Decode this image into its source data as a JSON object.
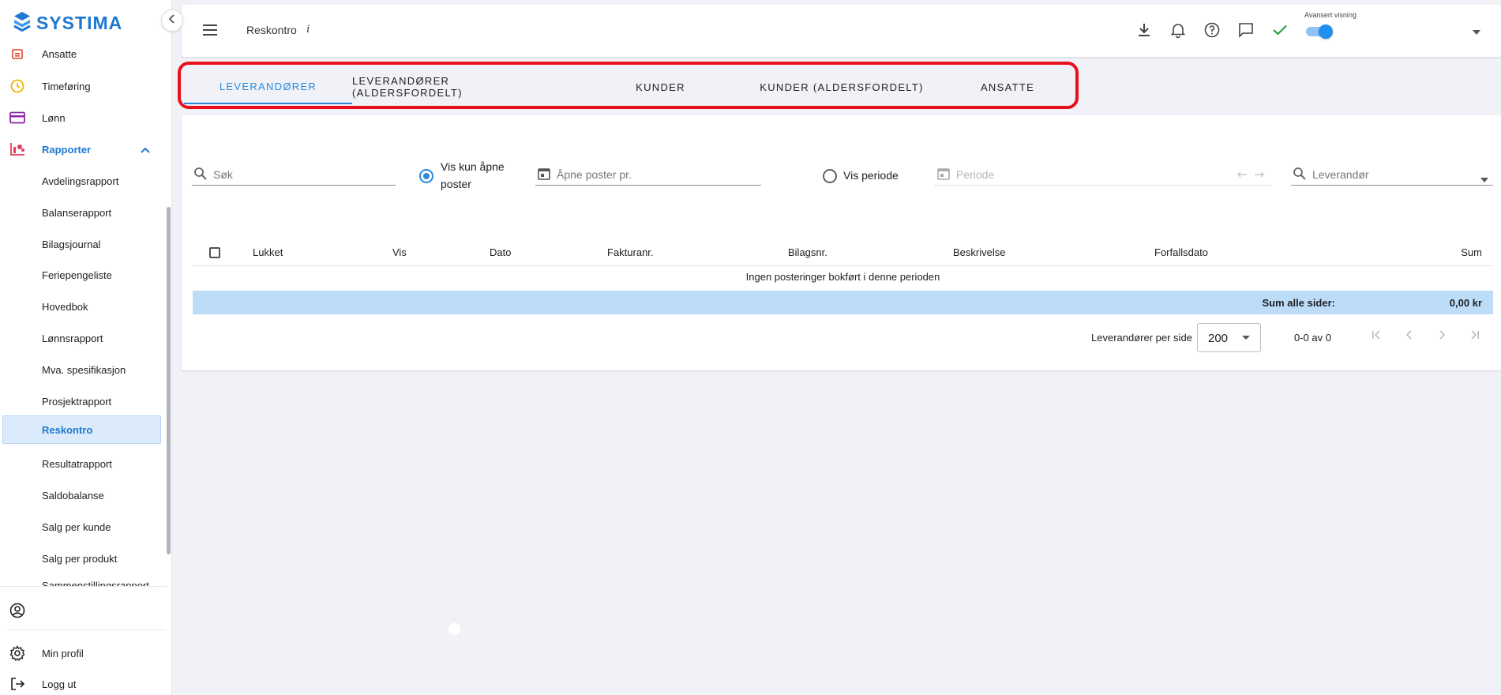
{
  "app": {
    "brand": "SYSTIMA"
  },
  "colors": {
    "accent": "#2a8bdf",
    "brand": "#1f78d1",
    "highlight": "#e8101a",
    "sum_row": "#bcdcf7"
  },
  "sidebar": {
    "collapse_icon": "chevron-left-icon",
    "items": [
      {
        "label": "Ansatte",
        "icon": "calendar-icon"
      },
      {
        "label": "Timeføring",
        "icon": "clock-icon"
      },
      {
        "label": "Lønn",
        "icon": "credit-card-icon"
      },
      {
        "label": "Rapporter",
        "icon": "reports-icon"
      }
    ],
    "sub_items": [
      {
        "label": "Avdelingsrapport"
      },
      {
        "label": "Balanserapport"
      },
      {
        "label": "Bilagsjournal"
      },
      {
        "label": "Feriepengeliste"
      },
      {
        "label": "Hovedbok"
      },
      {
        "label": "Lønnsrapport"
      },
      {
        "label": "Mva. spesifikasjon"
      },
      {
        "label": "Prosjektrapport"
      },
      {
        "label": "Reskontro",
        "active": true
      },
      {
        "label": "Resultatrapport"
      },
      {
        "label": "Saldobalanse"
      },
      {
        "label": "Salg per kunde"
      },
      {
        "label": "Salg per produkt"
      },
      {
        "label": "Sammenstillingsrapport"
      }
    ],
    "bottom": {
      "profile_icon": "user-circle-icon",
      "my_profile": "Min profil",
      "logout": "Logg ut"
    }
  },
  "topbar": {
    "breadcrumb": "Reskontro",
    "info": "i",
    "toggle_label": "Avansert visning",
    "toggle_on": true
  },
  "tabs": [
    {
      "label": "LEVERANDØRER",
      "active": true
    },
    {
      "label": "LEVERANDØRER (ALDERSFORDELT)"
    },
    {
      "label": "KUNDER"
    },
    {
      "label": "KUNDER (ALDERSFORDELT)"
    },
    {
      "label": "ANSATTE"
    }
  ],
  "filters": {
    "search_placeholder": "Søk",
    "radio_open_label": "Vis kun åpne poster",
    "radio_open_checked": true,
    "open_posts_placeholder": "Åpne poster pr.",
    "radio_period_label": "Vis periode",
    "radio_period_checked": false,
    "period_placeholder": "Periode",
    "supplier_placeholder": "Leverandør"
  },
  "table": {
    "columns": [
      "Lukket",
      "Vis",
      "Dato",
      "Fakturanr.",
      "Bilagsnr.",
      "Beskrivelse",
      "Forfallsdato",
      "Sum"
    ],
    "rows": [],
    "empty_message": "Ingen posteringer bokført i denne perioden",
    "sum_label": "Sum alle sider:",
    "sum_value": "0,00 kr"
  },
  "pagination": {
    "per_page_label": "Leverandører per side",
    "per_page_value": "200",
    "range": "0-0 av 0"
  }
}
